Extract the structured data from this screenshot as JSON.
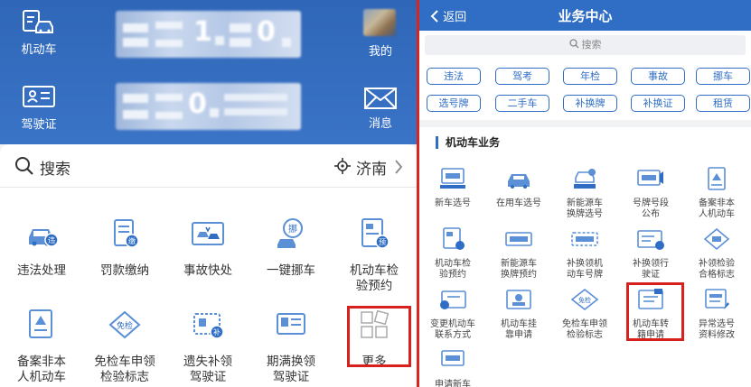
{
  "left": {
    "top": {
      "vehicle_label": "机动车",
      "license_label": "驾驶证",
      "mine_label": "我的",
      "message_label": "消息",
      "plate1_num_a": "1",
      "plate1_num_b": "0",
      "plate2_num_a": "0"
    },
    "search": {
      "placeholder": "搜索",
      "city": "济南"
    },
    "grid": [
      {
        "label": "违法处理",
        "icon": "violation-icon"
      },
      {
        "label": "罚款缴纳",
        "icon": "fine-icon"
      },
      {
        "label": "事故快处",
        "icon": "accident-icon"
      },
      {
        "label": "一键挪车",
        "icon": "move-car-icon"
      },
      {
        "label": "机动车检\n验预约",
        "icon": "inspection-icon"
      },
      {
        "label": "备案非本\n人机动车",
        "icon": "register-icon"
      },
      {
        "label": "免检车申领\n检验标志",
        "icon": "exempt-icon"
      },
      {
        "label": "遗失补领\n驾驶证",
        "icon": "replace-license-icon"
      },
      {
        "label": "期满换领\n驾驶证",
        "icon": "renew-license-icon"
      },
      {
        "label": "更多",
        "icon": "more-icon"
      }
    ]
  },
  "right": {
    "header": {
      "back": "返回",
      "title": "业务中心"
    },
    "search_placeholder": "搜索",
    "tags": [
      "违法",
      "驾考",
      "年检",
      "事故",
      "挪车",
      "选号牌",
      "二手车",
      "补换牌",
      "补换证",
      "租赁"
    ],
    "section_title": "机动车业务",
    "services": [
      "新车选号",
      "在用车选号",
      "新能源车\n换牌选号",
      "号牌号段\n公布",
      "备案非本\n人机动车",
      "机动车检\n验预约",
      "新能源车\n换牌预约",
      "补换领机\n动车号牌",
      "补换领行\n驶证",
      "补领检验\n合格标志",
      "变更机动车\n联系方式",
      "机动车挂\n靠申请",
      "免检车申领\n检验标志",
      "机动车转\n籍申请",
      "异常选号\n资料修改",
      "申请新车\n临时号牌"
    ]
  },
  "colors": {
    "primary": "#2f6ec4",
    "highlight": "#d8211d"
  }
}
